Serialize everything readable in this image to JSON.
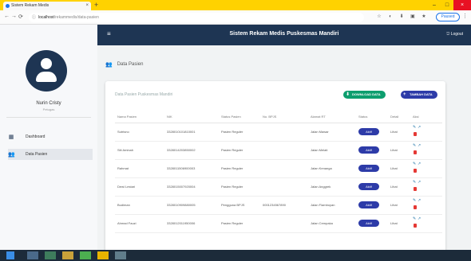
{
  "browser": {
    "tab_title": "Sistem Rekam Medis",
    "tab_close": "×",
    "new_tab": "+",
    "url_host": "localhost",
    "url_path": "/rekammedis/data-pasien",
    "window_controls": [
      "–",
      "□",
      "×"
    ],
    "profile": "Paused",
    "menu": "⋮",
    "nav": [
      "←",
      "→",
      "⟳"
    ],
    "extensions": [
      "☆",
      "◐",
      "⬇",
      "▣",
      "★"
    ]
  },
  "sidebar": {
    "user_name": "Nurin Cristy",
    "user_role": "Petugas",
    "items": [
      {
        "label": "Dashboard",
        "icon": "dashboard-icon",
        "glyph": "▦",
        "active": false
      },
      {
        "label": "Data Pasien",
        "icon": "users-icon",
        "glyph": "👥",
        "active": true
      }
    ]
  },
  "appbar": {
    "menu_glyph": "≡",
    "title": "Sistem Rekam Medis Puskesmas Mandiri",
    "logout": "⎋ Logout"
  },
  "main": {
    "breadcrumb_icon": "👥",
    "breadcrumb": "Data Pasien",
    "card_title": "Data Pasien Puskesmas Mandiri",
    "btn_download": "DOWNLOAD DATA",
    "btn_add": "TAMBAH DATA",
    "btn_download_icon": "⬇",
    "btn_add_icon": "+",
    "table": {
      "headers": [
        "Nama Pasien",
        "NIK",
        "Status Pasien",
        "No. BPJS",
        "Alamat RT",
        "Status",
        "Detail",
        "Aksi"
      ],
      "rows": [
        {
          "nama": "Sutrisno",
          "nik": "3328010101810001",
          "jenis": "Pasien Reguler",
          "bpjs": "",
          "alamat": "Jalan Mawar",
          "status": "Aktif",
          "detail": "Lihat"
        },
        {
          "nama": "Siti Aminah",
          "nik": "3328014203850002",
          "jenis": "Pasien Reguler",
          "bpjs": "",
          "alamat": "Jalan Melati",
          "status": "Aktif",
          "detail": "Lihat"
        },
        {
          "nama": "Rahmat",
          "nik": "3328011506900003",
          "jenis": "Pasien Reguler",
          "bpjs": "",
          "alamat": "Jalan Kenanga",
          "status": "Aktif",
          "detail": "Lihat"
        },
        {
          "nama": "Dewi Lestari",
          "nik": "3328015007920004",
          "jenis": "Pasien Reguler",
          "bpjs": "",
          "alamat": "Jalan Anggrek",
          "status": "Aktif",
          "detail": "Lihat"
        },
        {
          "nama": "Budiman",
          "nik": "3328010909880005",
          "jenis": "Pengguna BPJS",
          "bpjs": "0001234567890",
          "alamat": "Jalan Flamboyan",
          "status": "Aktif",
          "detail": "Lihat"
        },
        {
          "nama": "Ahmad Fauzi",
          "nik": "3328012011950006",
          "jenis": "Pasien Reguler",
          "bpjs": "",
          "alamat": "Jalan Cempaka",
          "status": "Aktif",
          "detail": "Lihat"
        }
      ]
    }
  },
  "colors": {
    "appbar": "#1e3553",
    "accent_green": "#0d9e6e",
    "accent_blue": "#2d3ba8",
    "tabbar": "#ffd200"
  }
}
